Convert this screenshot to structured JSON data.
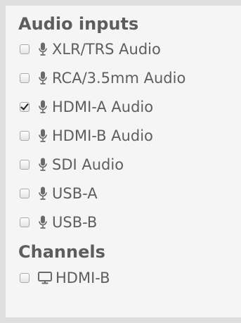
{
  "audio_inputs": {
    "title": "Audio inputs",
    "items": [
      {
        "label": "XLR/TRS Audio",
        "checked": false
      },
      {
        "label": "RCA/3.5mm Audio",
        "checked": false
      },
      {
        "label": "HDMI-A Audio",
        "checked": true
      },
      {
        "label": "HDMI-B Audio",
        "checked": false
      },
      {
        "label": "SDI Audio",
        "checked": false
      },
      {
        "label": "USB-A",
        "checked": false
      },
      {
        "label": "USB-B",
        "checked": false
      }
    ]
  },
  "channels": {
    "title": "Channels",
    "items": [
      {
        "label": "HDMI-B",
        "checked": false
      }
    ]
  },
  "icons": {
    "audio_item": "microphone-icon",
    "channel_item": "monitor-icon"
  },
  "colors": {
    "panel_background": "#f5f5f5",
    "panel_border": "#dedede",
    "text": "#5e5e5e",
    "icon": "#6a6a6a"
  }
}
